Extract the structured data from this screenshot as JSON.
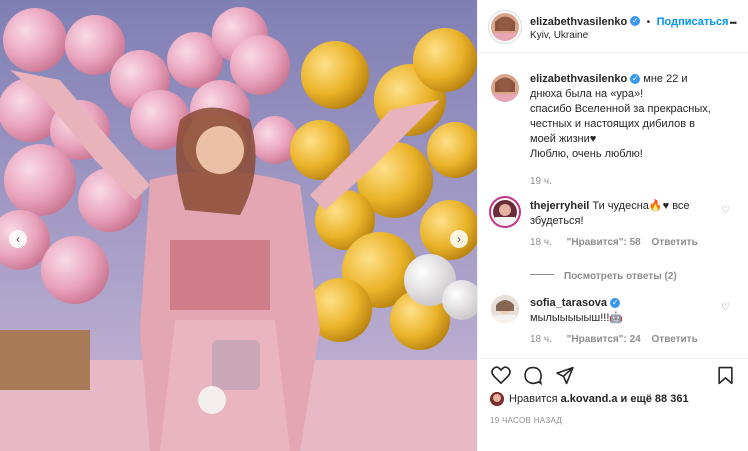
{
  "post": {
    "username": "elizabethvasilenko",
    "follow_label": "Подписаться",
    "separator": "•",
    "location": "Kyiv, Ukraine"
  },
  "caption": {
    "username": "elizabethvasilenko",
    "lines": [
      "мне 22 и",
      "днюха была на «ура»!",
      "спасибо Вселенной за прекрасных,",
      "честных и настоящих дибилов в",
      "моей жизни♥",
      "Люблю, очень люблю!"
    ],
    "time": "19 ч."
  },
  "comments": [
    {
      "username": "thejerryheil",
      "text_line1": "Ти чудесна🔥♥ все",
      "text_line2": "збудеться!",
      "time": "18 ч.",
      "likes": "\"Нравится\": 58",
      "reply": "Ответить",
      "view_replies": "Посмотреть ответы (2)"
    },
    {
      "username": "sofia_tarasova",
      "text_line1": "мылыыыыыш!!!🤖",
      "time": "18 ч.",
      "likes": "\"Нравится\": 24",
      "reply": "Ответить"
    }
  ],
  "likes_text": {
    "prefix": "Нравится",
    "user": "a.kovand.a",
    "suffix": "и ещё 88 361"
  },
  "timestamp": "19 ЧАСОВ НАЗАД",
  "icons": {
    "nav_prev": "‹",
    "nav_next": "›",
    "verified": "✓",
    "heart": "♡",
    "more": "•••"
  },
  "colors": {
    "accent": "#0095f6",
    "verified": "#3897f0",
    "muted": "#8e8e8e",
    "pink_balloon": "#e8a8bf",
    "yellow_balloon": "#e9b521"
  }
}
